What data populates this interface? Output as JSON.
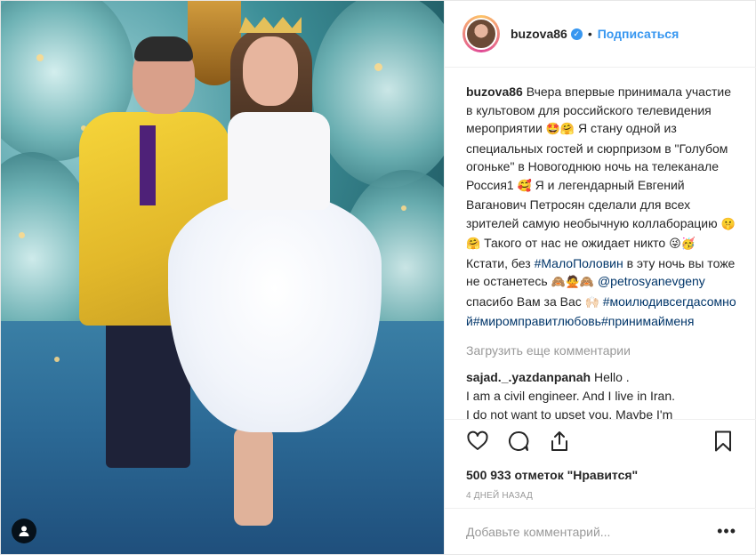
{
  "header": {
    "username": "buzova86",
    "verified_mark": "✓",
    "dot": "•",
    "follow_label": "Подписаться"
  },
  "caption": {
    "username": "buzova86",
    "p1": "Вчера впервые принимала участие в культовом для российского телевидения мероприятии",
    "e1": "🤩🤗",
    "p2": "Я стану одной из специальных гостей и сюрпризом в \"Голубом огоньке\" в Новогоднюю ночь на телеканале Россия1",
    "e2": "🥰",
    "p3": "Я и легендарный Евгений Ваганович Петросян сделали для всех зрителей самую необычную коллаборацию",
    "e3": "🤫🤗",
    "p4": "Такого от нас не ожидает никто",
    "e4": "😜🥳",
    "p5": "Кстати, без",
    "tag1": "#МалоПоловин",
    "p6": "в эту ночь вы тоже не останетесь",
    "e5": "🙈🙅🙈",
    "mention": "@petrosyanevgeny",
    "p7": "спасибо Вам за Вас",
    "e6": "🙌🏻",
    "tags2": "#моилюдивсегдасомной#миромправитлюбовь#принимайменя"
  },
  "load_more": "Загрузить еще комментарии",
  "comment": {
    "username": "sajad._.yazdanpanah",
    "text1": "Hello .",
    "text2": "I am a civil engineer. And I live in Iran.",
    "text3": "I do not want to upset you. Maybe I'm"
  },
  "likes": "500 933 отметок \"Нравится\"",
  "timestamp": "4 ДНЕЙ НАЗАД",
  "add_comment_placeholder": "Добавьте комментарий...",
  "more_dots": "•••",
  "icons": [
    "heart-icon",
    "comment-icon",
    "share-icon",
    "bookmark-icon",
    "user-tag-icon"
  ],
  "colors": {
    "link": "#3897f0",
    "hashtag": "#003569",
    "muted": "#999999"
  }
}
